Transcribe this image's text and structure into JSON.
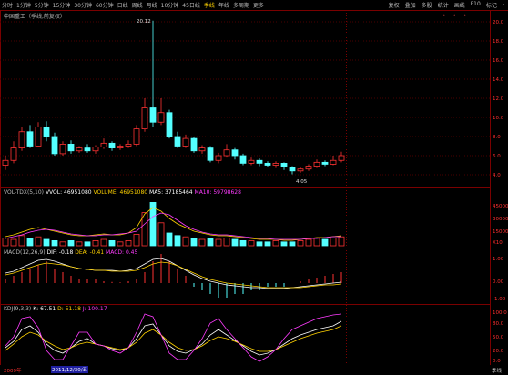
{
  "toolbar": {
    "timeframes": [
      "分时",
      "1分钟",
      "5分钟",
      "15分钟",
      "30分钟",
      "60分钟",
      "日线",
      "周线",
      "月线",
      "10分钟",
      "45日线",
      "季线",
      "年线",
      "多周期",
      "更多"
    ],
    "right_items": [
      "复权",
      "叠加",
      "多股",
      "统计",
      "画线",
      "F10",
      "标记",
      "-"
    ]
  },
  "title": "中国重工（季线,前复权）",
  "price_annotations": {
    "high": "20.12",
    "low": "4.05"
  },
  "price_axis": [
    "20.0",
    "18.0",
    "16.0",
    "14.0",
    "12.0",
    "10.0",
    "8.0",
    "6.0",
    "4.0"
  ],
  "vol_panel": {
    "label": "VOL-TDX(5,10)",
    "vvol": "VVOL: 46951080",
    "volume": "VOLUME: 46951080",
    "ma5": "MA5: 37185464",
    "ma10": "MA10: 59798628",
    "axis": [
      "45000",
      "30000",
      "15000",
      "X10"
    ]
  },
  "macd_panel": {
    "label": "MACD(12,26,9)",
    "dif": "DIF: -0.18",
    "dea": "DEA: -0.41",
    "macd": "MACD: 0.45",
    "axis": [
      "1.00",
      "0.00",
      "-1.00"
    ]
  },
  "kdj_panel": {
    "label": "KDJ(9,3,3)",
    "k": "K: 67.51",
    "d": "D: 51.18",
    "j": "J: 100.17",
    "axis": [
      "100.0",
      "80.0",
      "50.0",
      "20.0",
      "0.0"
    ]
  },
  "date_axis": {
    "first": "2009年",
    "selected": "2011/12/30/五",
    "tail": "季线"
  },
  "colors": {
    "up": "#ff3232",
    "down": "#54ffff",
    "ma_yellow": "#ffd200",
    "ma_magenta": "#ff3cff",
    "white": "#ffffff",
    "grid": "#7a0000"
  }
}
